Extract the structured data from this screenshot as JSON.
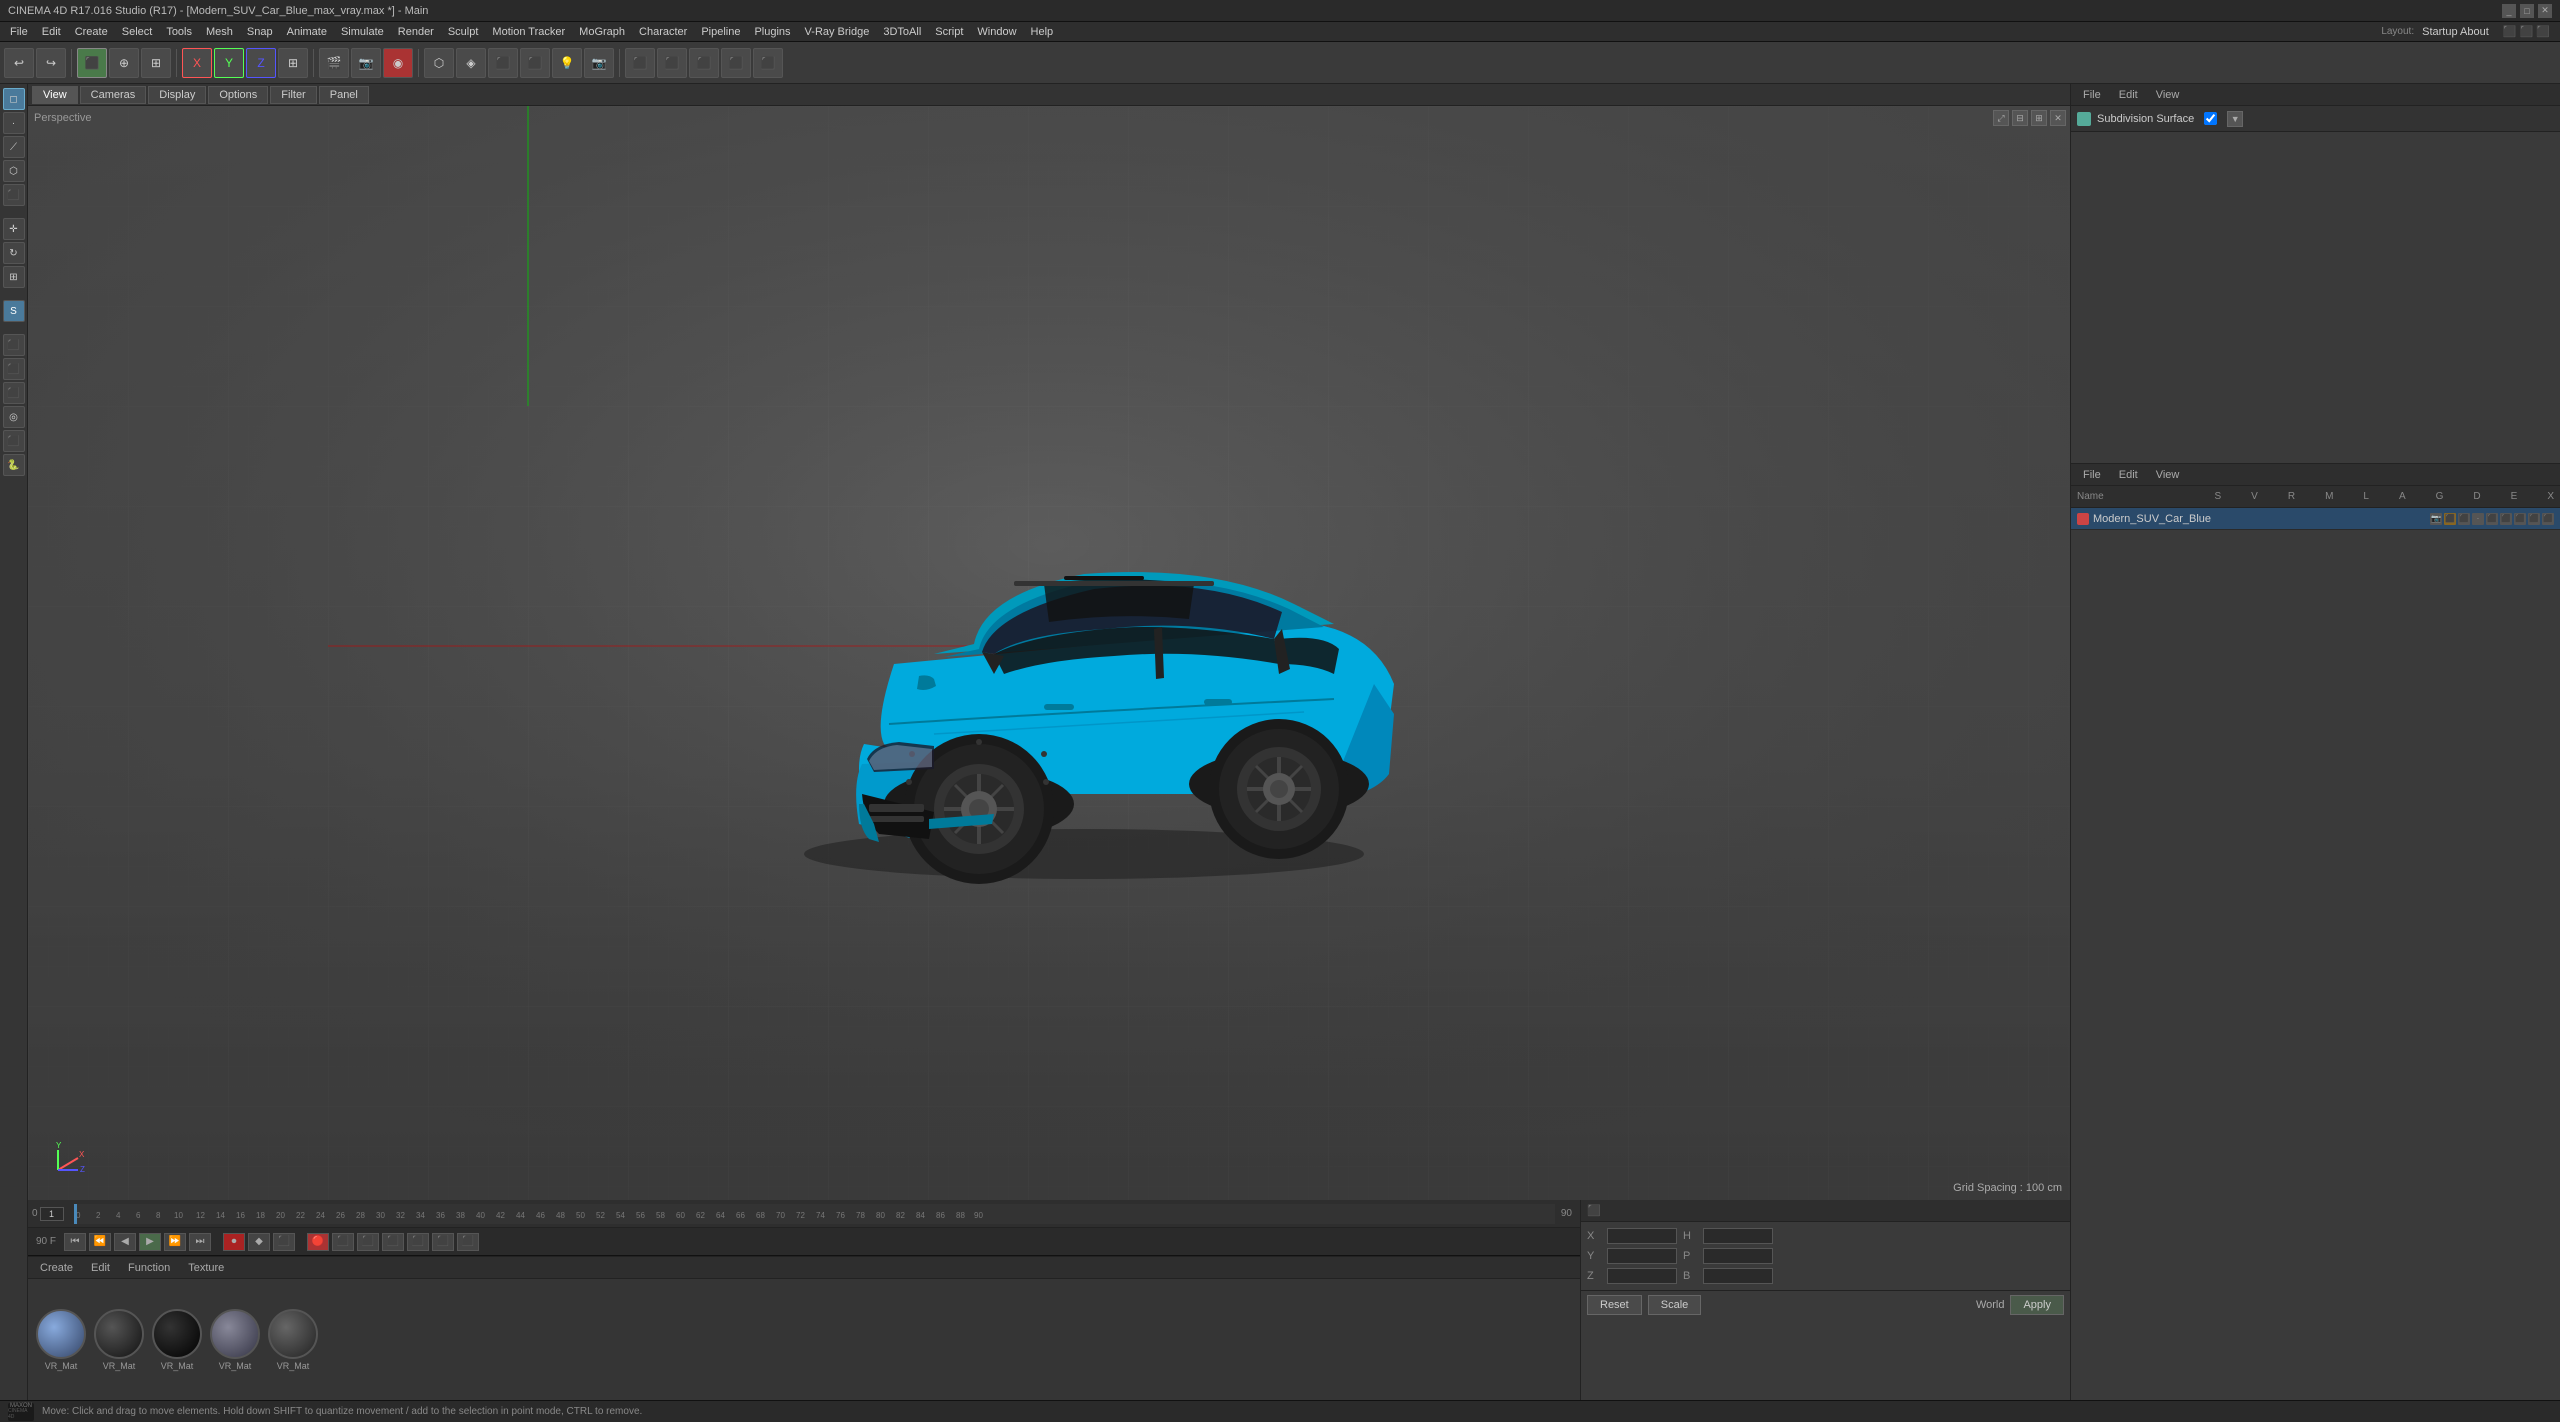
{
  "app": {
    "title": "CINEMA 4D R17.016 Studio (R17) - [Modern_SUV_Car_Blue_max_vray.max *] - Main",
    "layout_label": "Layout:",
    "startup_label": "Startup About"
  },
  "menu": {
    "items": [
      "File",
      "Edit",
      "Create",
      "Select",
      "Tools",
      "Mesh",
      "Snap",
      "Animate",
      "Simulate",
      "Render",
      "Sculpt",
      "Motion Tracker",
      "MoGraph",
      "Character",
      "Pipeline",
      "Plugins",
      "V-Ray Bridge",
      "3DToAll",
      "Script",
      "Window",
      "Help"
    ]
  },
  "viewport": {
    "label": "Perspective",
    "grid_spacing": "Grid Spacing : 100 cm"
  },
  "attr_manager": {
    "tabs": [
      "File",
      "Edit",
      "View"
    ],
    "subdivision_label": "Subdivision Surface"
  },
  "obj_manager": {
    "tabs": [
      "File",
      "Edit",
      "View"
    ],
    "header": {
      "name": "Name",
      "columns": [
        "S",
        "V",
        "R",
        "M",
        "L",
        "A",
        "G",
        "D",
        "E",
        "X"
      ]
    },
    "objects": [
      {
        "name": "Modern_SUV_Car_Blue",
        "icon_color": "#cc4444"
      }
    ]
  },
  "transport": {
    "frame_display": "90 F",
    "frame_input": "1"
  },
  "timeline": {
    "start": "0",
    "end": "90",
    "marks": [
      "0",
      "2",
      "4",
      "6",
      "8",
      "10",
      "12",
      "14",
      "16",
      "18",
      "20",
      "22",
      "24",
      "26",
      "28",
      "30",
      "32",
      "34",
      "36",
      "38",
      "40",
      "42",
      "44",
      "46",
      "48",
      "50",
      "52",
      "54",
      "56",
      "58",
      "60",
      "62",
      "64",
      "66",
      "68",
      "70",
      "72",
      "74",
      "76",
      "78",
      "80",
      "82",
      "84",
      "86",
      "88",
      "90"
    ]
  },
  "material_tabs": {
    "labels": [
      "Create",
      "Edit",
      "Function",
      "Texture"
    ]
  },
  "materials": [
    {
      "label": "VR_Mat",
      "color": "#5577aa",
      "gradient": "radial-gradient(circle at 35% 35%, #88aadd, #334466)"
    },
    {
      "label": "VR_Mat",
      "color": "#333",
      "gradient": "radial-gradient(circle at 35% 35%, #555, #111)"
    },
    {
      "label": "VR_Mat",
      "color": "#111",
      "gradient": "radial-gradient(circle at 35% 35%, #333, #000)"
    },
    {
      "label": "VR_Mat",
      "color": "#667",
      "gradient": "radial-gradient(circle at 35% 35%, #889, #334)"
    },
    {
      "label": "VR_Mat",
      "color": "#444",
      "gradient": "radial-gradient(circle at 35% 35%, #666, #222)"
    }
  ],
  "coordinates": {
    "x_label": "X",
    "y_label": "Y",
    "z_label": "Z",
    "x_pos": "",
    "y_pos": "",
    "z_pos": "",
    "x_size": "",
    "y_size": "",
    "z_size": "",
    "h_label": "H",
    "p_label": "P",
    "b_label": "B",
    "h_val": "",
    "p_val": "",
    "b_val": "",
    "reset_label": "Reset",
    "scale_label": "Scale",
    "apply_label": "Apply",
    "world_label": "World"
  },
  "status_bar": {
    "message": "Move: Click and drag to move elements. Hold down SHIFT to quantize movement / add to the selection in point mode, CTRL to remove."
  },
  "toolbar_buttons": [
    "↩",
    "↪",
    "⬛",
    "⬚",
    "⊕",
    "X",
    "Y",
    "Z",
    "⊞",
    "🎬",
    "📷",
    "◉",
    "⊕",
    "▶",
    "⬡",
    "◈",
    "🔍",
    "⬛",
    "⬛",
    "⬛",
    "⬛",
    "⬛",
    "⬛",
    "⬛",
    "💡"
  ],
  "left_tools": [
    "◻",
    "⟳",
    "✂",
    "⊕",
    "↗",
    "⬡",
    "◎",
    "S",
    "↻",
    "⬛",
    "⬛",
    "⬛",
    "⬛"
  ]
}
